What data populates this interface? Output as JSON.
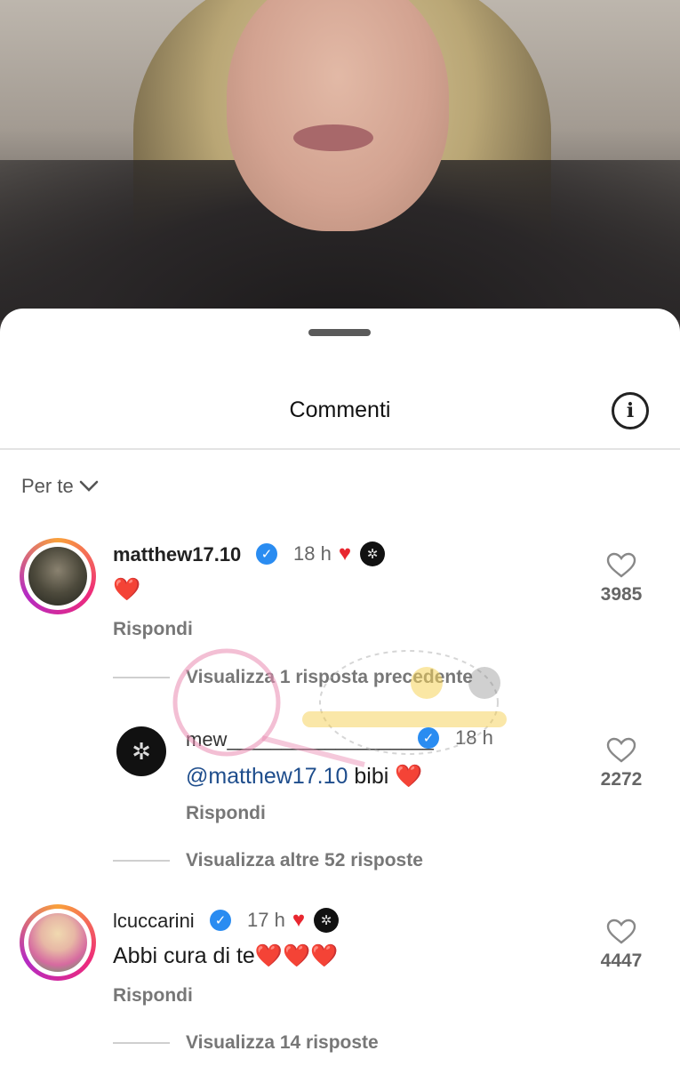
{
  "sheet": {
    "title": "Commenti",
    "info_icon": "info-icon",
    "filter_label": "Per te"
  },
  "comments": [
    {
      "username": "matthew17.10",
      "verified": true,
      "time": "18 h",
      "text": "❤️",
      "reply_label": "Rispondi",
      "likes": "3985",
      "thread_link": "Visualizza 1 risposta precedente"
    },
    {
      "username": "lcuccarini",
      "verified": true,
      "time": "17 h",
      "text": "Abbi cura di te❤️❤️❤️",
      "reply_label": "Rispondi",
      "likes": "4447",
      "thread_link": "Visualizza 14 risposte"
    }
  ],
  "reply": {
    "username": "mew___________________",
    "verified": true,
    "time": "18 h",
    "mention": "@matthew17.10",
    "text": " bibi ❤️",
    "reply_label": "Rispondi",
    "likes": "2272",
    "thread_link": "Visualizza altre 52 risposte"
  },
  "colors": {
    "verified": "#2a8cf1",
    "heart": "#e8262f",
    "mention": "#1e4d8c"
  }
}
